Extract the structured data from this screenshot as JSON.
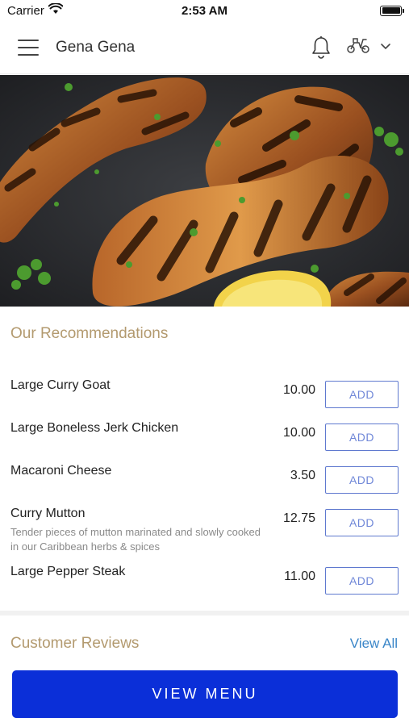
{
  "status_bar": {
    "carrier": "Carrier",
    "time": "2:53 AM"
  },
  "header": {
    "title": "Gena Gena",
    "icons": [
      "menu-icon",
      "bell-icon",
      "scooter-icon",
      "chevron-down-icon"
    ]
  },
  "hero": {
    "description_icon": "grilled-chicken-photo"
  },
  "recommendations": {
    "title": "Our Recommendations",
    "items": [
      {
        "name": "Large Curry Goat",
        "description": "",
        "price": "10.00",
        "add_label": "ADD"
      },
      {
        "name": "Large Boneless Jerk Chicken",
        "description": "",
        "price": "10.00",
        "add_label": "ADD"
      },
      {
        "name": "Macaroni Cheese",
        "description": "",
        "price": "3.50",
        "add_label": "ADD"
      },
      {
        "name": "Curry Mutton",
        "description": "Tender pieces of mutton marinated and slowly cooked in our Caribbean herbs & spices",
        "price": "12.75",
        "add_label": "ADD"
      },
      {
        "name": "Large Pepper Steak",
        "description": "",
        "price": "11.00",
        "add_label": "ADD"
      }
    ]
  },
  "reviews": {
    "title": "Customer Reviews",
    "view_all_label": "View All"
  },
  "footer": {
    "view_menu_label": "VIEW MENU"
  },
  "colors": {
    "accent_gold": "#b39a6f",
    "primary_blue": "#0b2fd8",
    "link_blue": "#3a86c8",
    "add_border": "#5f79cf"
  }
}
